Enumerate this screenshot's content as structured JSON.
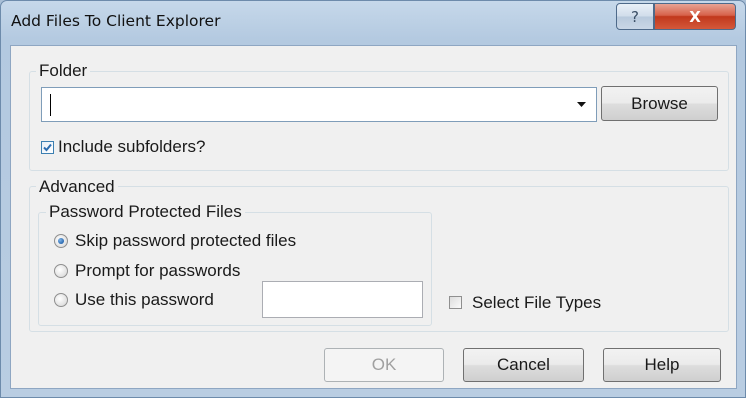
{
  "window": {
    "title": "Add Files To Client Explorer",
    "help_glyph": "?",
    "close_glyph": "X"
  },
  "folder_group": {
    "legend": "Folder",
    "folder_input_value": "",
    "browse_label": "Browse",
    "include_subfolders": {
      "label": "Include subfolders?",
      "checked": true
    }
  },
  "advanced_group": {
    "legend": "Advanced",
    "password_group": {
      "legend": "Password Protected Files",
      "options": [
        {
          "label": "Skip password protected files",
          "selected": true
        },
        {
          "label": "Prompt for passwords",
          "selected": false
        },
        {
          "label": "Use this password",
          "selected": false
        }
      ],
      "password_value": ""
    },
    "select_file_types": {
      "label": "Select File Types",
      "checked": false
    }
  },
  "buttons": {
    "ok_label": "OK",
    "ok_enabled": false,
    "cancel_label": "Cancel",
    "help_label": "Help"
  },
  "colors": {
    "accent_check": "#2b6cb0",
    "radio_dot": "#1e5ea8",
    "close_button": "#c1381c"
  }
}
